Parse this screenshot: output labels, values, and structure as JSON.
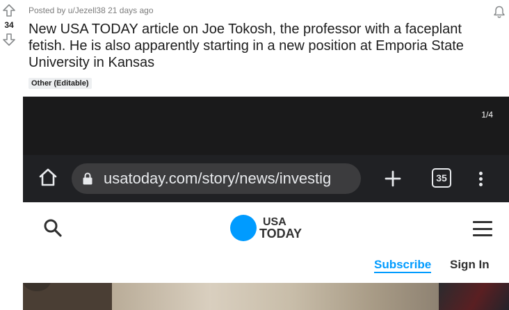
{
  "post": {
    "score": "34",
    "meta_prefix": "Posted by",
    "author": "u/Jezell38",
    "age": "21 days ago",
    "title": "New USA TODAY article on Joe Tokosh, the professor with a faceplant fetish. He is also apparently starting in a new position at Emporia State University in Kansas",
    "flair": "Other (Editable)"
  },
  "gallery": {
    "counter": "1/4"
  },
  "browser": {
    "url": "usatoday.com/story/news/investig",
    "tab_count": "35"
  },
  "site": {
    "logo_line1": "USA",
    "logo_line2": "TODAY",
    "subscribe": "Subscribe",
    "sign_in": "Sign In"
  },
  "colors": {
    "usatoday_blue": "#009bff",
    "browser_bar": "#202124",
    "meta_gray": "#7c7c7c"
  },
  "icons": [
    "upvote-icon",
    "downvote-icon",
    "bell-icon",
    "home-icon",
    "lock-icon",
    "plus-icon",
    "tabs-icon",
    "kebab-icon",
    "search-icon",
    "hamburger-icon"
  ]
}
